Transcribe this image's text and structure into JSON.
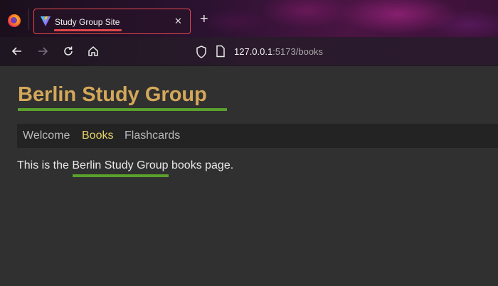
{
  "browser": {
    "tab": {
      "title": "Study Group Site",
      "close_icon": "close-icon"
    },
    "new_tab_label": "+",
    "url": {
      "host": "127.0.0.1",
      "path": ":5173/books"
    }
  },
  "site": {
    "title": "Berlin Study Group",
    "nav": [
      {
        "label": "Welcome",
        "active": false
      },
      {
        "label": "Books",
        "active": true
      },
      {
        "label": "Flashcards",
        "active": false
      }
    ],
    "body": {
      "prefix": "This is the ",
      "highlight": "Berlin Study Group",
      "suffix": " books page."
    }
  },
  "colors": {
    "title": "#d4a85a",
    "underline": "#5aa02c",
    "active_nav": "#e6d16a",
    "tab_highlight": "#e0474c"
  }
}
